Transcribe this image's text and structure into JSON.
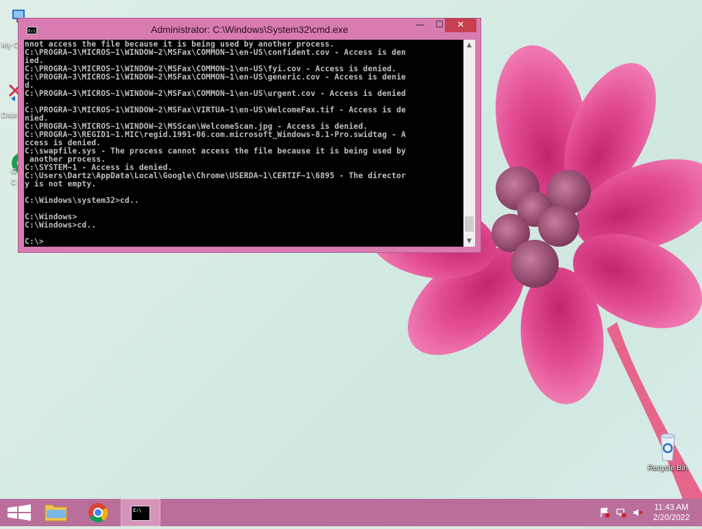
{
  "window": {
    "title": "Administrator: C:\\Windows\\System32\\cmd.exe",
    "icon_label": "C:\\",
    "controls": {
      "minimize": "—",
      "maximize": "☐",
      "close": "✕"
    }
  },
  "console": {
    "lines": [
      "nnot access the file because it is being used by another process.",
      "C:\\PROGRA~3\\MICROS~1\\WINDOW~2\\MSFax\\COMMON~1\\en-US\\confident.cov - Access is den",
      "ied.",
      "C:\\PROGRA~3\\MICROS~1\\WINDOW~2\\MSFax\\COMMON~1\\en-US\\fyi.cov - Access is denied.",
      "C:\\PROGRA~3\\MICROS~1\\WINDOW~2\\MSFax\\COMMON~1\\en-US\\generic.cov - Access is denie",
      "d.",
      "C:\\PROGRA~3\\MICROS~1\\WINDOW~2\\MSFax\\COMMON~1\\en-US\\urgent.cov - Access is denied",
      ".",
      "C:\\PROGRA~3\\MICROS~1\\WINDOW~2\\MSFax\\VIRTUA~1\\en-US\\WelcomeFax.tif - Access is de",
      "nied.",
      "C:\\PROGRA~3\\MICROS~1\\WINDOW~2\\MSScan\\WelcomeScan.jpg - Access is denied.",
      "C:\\PROGRA~3\\REGID1~1.MIC\\regid.1991-06.com.microsoft_Windows-8.1-Pro.swidtag - A",
      "ccess is denied.",
      "C:\\swapfile.sys - The process cannot access the file because it is being used by",
      " another process.",
      "C:\\SYSTEM~1 - Access is denied.",
      "C:\\Users\\Dartz\\AppData\\Local\\Google\\Chrome\\USERDA~1\\CERTIF~1\\6895 - The director",
      "y is not empty.",
      "",
      "C:\\Windows\\system32>cd..",
      "",
      "C:\\Windows>",
      "C:\\Windows>cd..",
      "",
      "C:\\>"
    ]
  },
  "desktop": {
    "icons": [
      {
        "label": "My C",
        "icon": "computer-icon"
      },
      {
        "label": "Date",
        "icon": "shortcut-icon"
      },
      {
        "label": "G\nC",
        "icon": "chrome-shortcut-icon"
      },
      {
        "label": "Recycle Bin",
        "icon": "recycle-bin-icon"
      }
    ]
  },
  "taskbar": {
    "items": [
      {
        "name": "start",
        "icon": "windows-logo-icon"
      },
      {
        "name": "file-explorer",
        "icon": "folder-icon"
      },
      {
        "name": "chrome",
        "icon": "chrome-icon"
      },
      {
        "name": "command-prompt",
        "icon": "cmd-icon",
        "label": "C:\\"
      }
    ],
    "clock": {
      "time": "11:43 AM",
      "date": "2/20/2022"
    }
  },
  "colors": {
    "accent": "#d87bb0",
    "taskbar": "#b96f9a",
    "close": "#c7404f"
  }
}
